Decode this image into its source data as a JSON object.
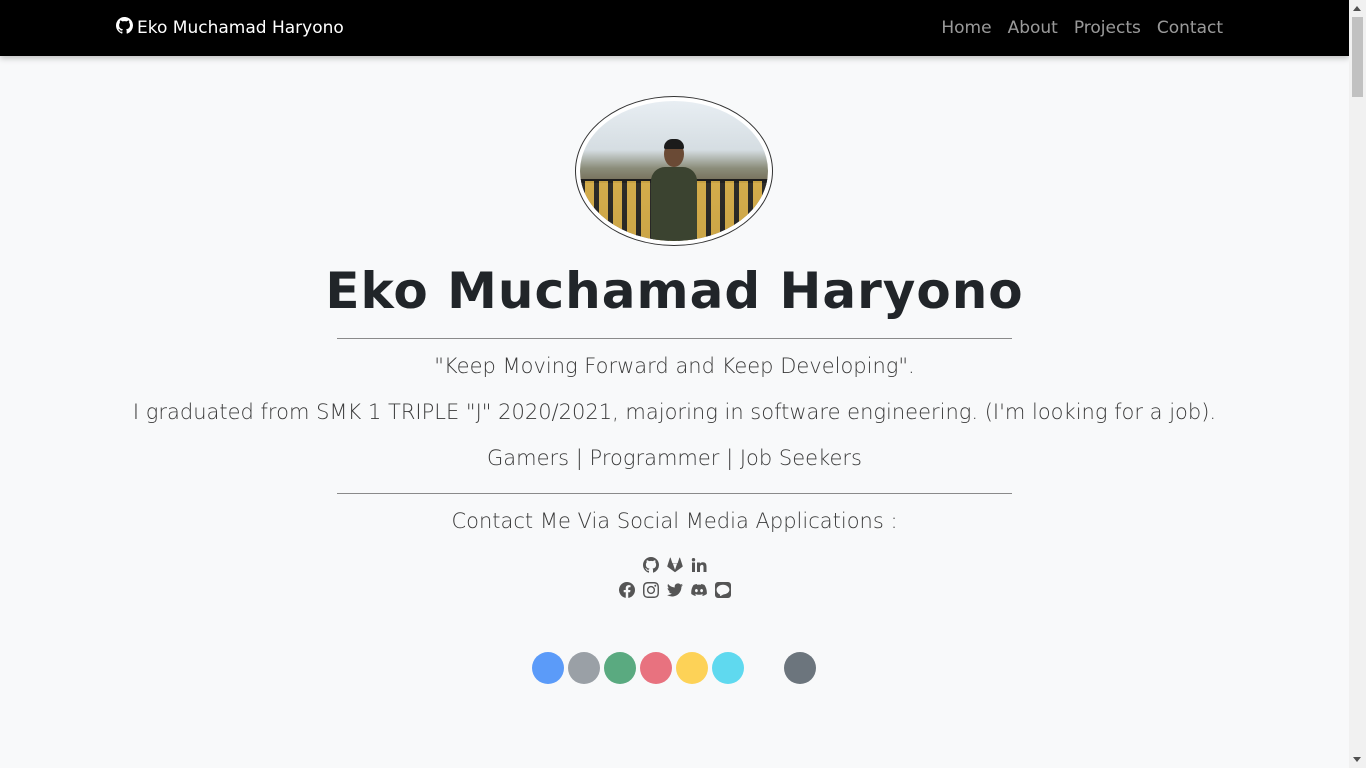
{
  "navbar": {
    "brand": "Eko Muchamad Haryono",
    "brand_icon": "github-icon",
    "links": [
      "Home",
      "About",
      "Projects",
      "Contact"
    ]
  },
  "profile": {
    "name": "Eko Muchamad Haryono",
    "quote": "\"Keep Moving Forward and Keep Developing\".",
    "education": "I graduated from SMK 1 TRIPLE \"J\" 2020/2021, majoring in software engineering. (I'm looking for a job).",
    "roles": "Gamers | Programmer | Job Seekers"
  },
  "contact": {
    "heading": "Contact Me Via Social Media Applications :",
    "row1_icons": [
      "github-icon",
      "gitlab-icon",
      "linkedin-icon"
    ],
    "row2_icons": [
      "facebook-icon",
      "instagram-icon",
      "twitter-icon",
      "discord-icon",
      "line-icon"
    ]
  },
  "theme_dots": {
    "colors": [
      "#5b9bf9",
      "#9aa0a6",
      "#5aaa80",
      "#e8727f",
      "#fdd257",
      "#5fd9ef",
      "transparent",
      "#6c757d"
    ]
  }
}
